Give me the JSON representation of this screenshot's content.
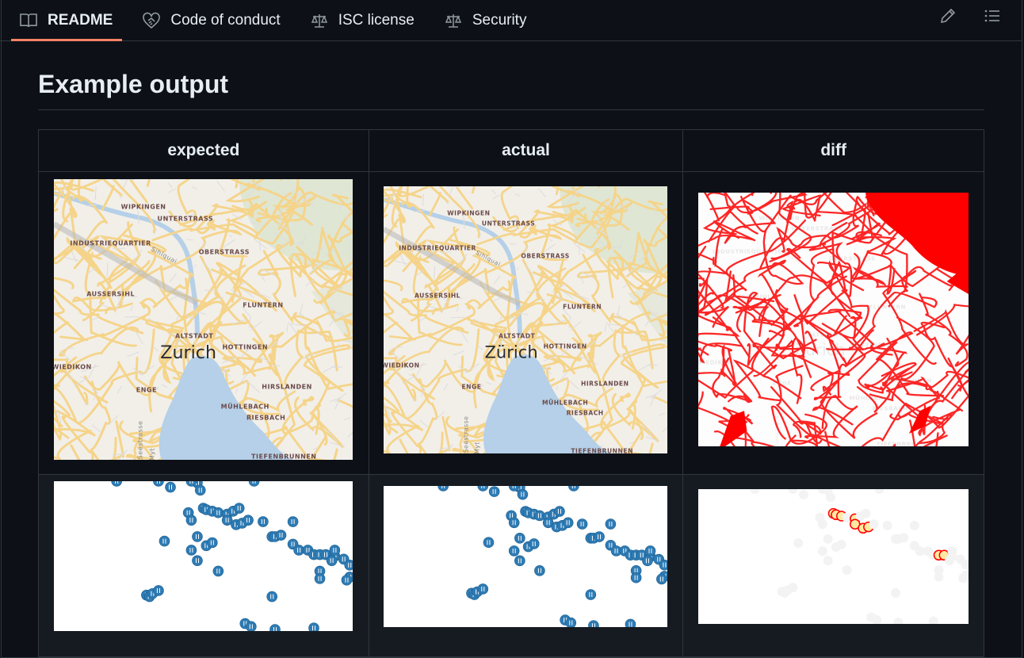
{
  "tabs": [
    {
      "label": "README",
      "icon": "book-icon",
      "active": true
    },
    {
      "label": "Code of conduct",
      "icon": "heart-handshake-icon"
    },
    {
      "label": "ISC license",
      "icon": "law-scale-icon"
    },
    {
      "label": "Security",
      "icon": "law-scale-icon"
    }
  ],
  "toolbar": {
    "edit_icon": "pencil-icon",
    "outline_icon": "list-unordered-icon"
  },
  "heading": "Example output",
  "table": {
    "headers": [
      "expected",
      "actual",
      "diff"
    ]
  },
  "map": {
    "labels": [
      "WIPKINGEN",
      "UNTERSTRASS",
      "INDUSTRIEQUARTIER",
      "Sihlquai",
      "OBERSTRASS",
      "AUSSERSIHL",
      "FLUNTERN",
      "ALTSTADT",
      "HOTTINGEN",
      "WIEDIKON",
      "ENGE",
      "HIRSLANDEN",
      "MÜHLEBACH",
      "RIESBACH",
      "TIEFENBRUNNEN",
      "Seestrasse",
      "Myt"
    ],
    "city_expected": "Zurich",
    "city_actual": "Zürich"
  },
  "colors": {
    "accent": "#f78166",
    "water": "#b5d0e8",
    "road": "#f5d48a",
    "land": "#f2efe9",
    "park": "#dfe6d3",
    "diff": "#ff0000",
    "marker": "#2e7bb4"
  }
}
